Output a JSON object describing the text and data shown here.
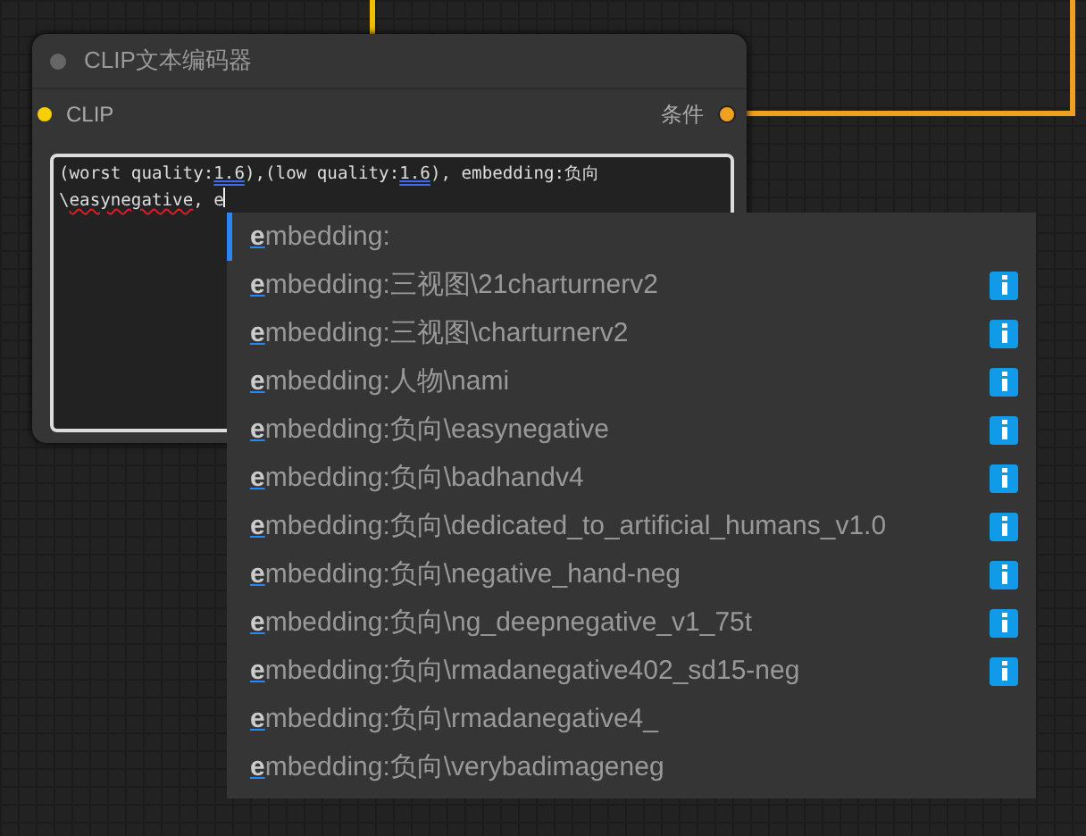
{
  "node": {
    "title": "CLIP文本编码器",
    "input": "CLIP",
    "output": "条件",
    "text": [
      {
        "text": "(worst quality:",
        "kind": "plain"
      },
      {
        "text": "1.6",
        "kind": "grammar"
      },
      {
        "text": "),(low quality:",
        "kind": "plain"
      },
      {
        "text": "1.6",
        "kind": "grammar"
      },
      {
        "text": "), embedding:负向",
        "kind": "plain"
      },
      {
        "text": "\\",
        "kind": "plain"
      },
      {
        "text": "easynegative",
        "kind": "spelling"
      },
      {
        "text": ", e",
        "kind": "plain"
      }
    ]
  },
  "autocomplete": [
    {
      "match": "e",
      "text": "mbedding:",
      "selected": true,
      "info": false
    },
    {
      "match": "e",
      "text": "mbedding:三视图\\21charturnerv2",
      "selected": false,
      "info": true
    },
    {
      "match": "e",
      "text": "mbedding:三视图\\charturnerv2",
      "selected": false,
      "info": true
    },
    {
      "match": "e",
      "text": "mbedding:人物\\nami",
      "selected": false,
      "info": true
    },
    {
      "match": "e",
      "text": "mbedding:负向\\easynegative",
      "selected": false,
      "info": true
    },
    {
      "match": "e",
      "text": "mbedding:负向\\badhandv4",
      "selected": false,
      "info": true
    },
    {
      "match": "e",
      "text": "mbedding:负向\\dedicated_to_artificial_humans_v1.0",
      "selected": false,
      "info": true
    },
    {
      "match": "e",
      "text": "mbedding:负向\\negative_hand-neg",
      "selected": false,
      "info": true
    },
    {
      "match": "e",
      "text": "mbedding:负向\\ng_deepnegative_v1_75t",
      "selected": false,
      "info": true
    },
    {
      "match": "e",
      "text": "mbedding:负向\\rmadanegative402_sd15-neg",
      "selected": false,
      "info": true
    },
    {
      "match": "e",
      "text": "mbedding:负向\\rmadanegative4_",
      "selected": false,
      "info": false
    },
    {
      "match": "e",
      "text": "mbedding:负向\\verybadimageneg",
      "selected": false,
      "info": false
    }
  ]
}
